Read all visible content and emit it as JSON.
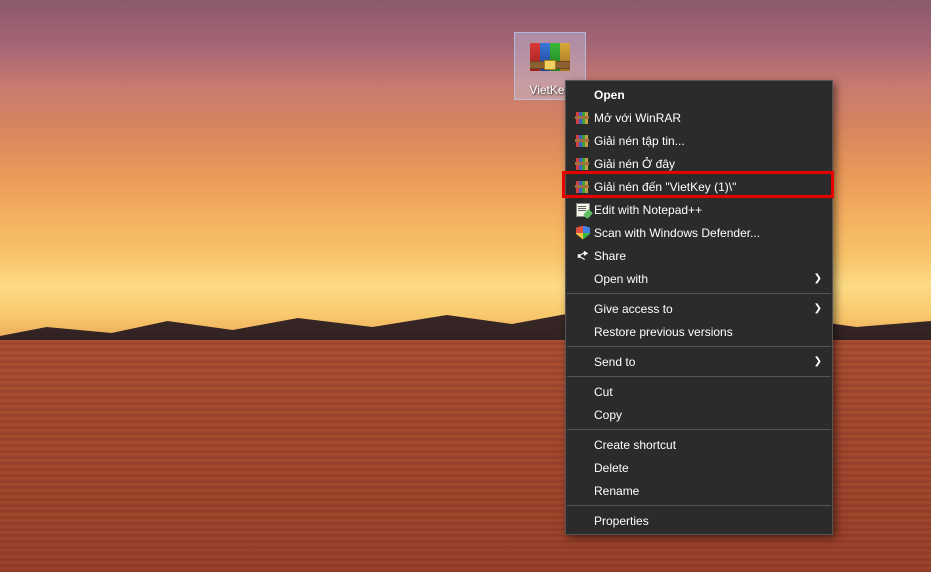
{
  "desktop": {
    "icon_label": "VietKey"
  },
  "context_menu": {
    "items": [
      {
        "label": "Open",
        "icon": null,
        "default": true,
        "submenu": false
      },
      {
        "label": "Mở với WinRAR",
        "icon": "winrar",
        "submenu": false
      },
      {
        "label": "Giải nén tập tin...",
        "icon": "winrar",
        "submenu": false
      },
      {
        "label": "Giải nén Ở đây",
        "icon": "winrar",
        "submenu": false
      },
      {
        "label": "Giải nén đến \"VietKey (1)\\\"",
        "icon": "winrar",
        "submenu": false,
        "highlighted": true
      },
      {
        "label": "Edit with Notepad++",
        "icon": "notepad",
        "submenu": false
      },
      {
        "label": "Scan with Windows Defender...",
        "icon": "shield",
        "submenu": false
      },
      {
        "label": "Share",
        "icon": "share",
        "submenu": false
      },
      {
        "label": "Open with",
        "icon": null,
        "submenu": true
      },
      {
        "sep": true
      },
      {
        "label": "Give access to",
        "icon": null,
        "submenu": true
      },
      {
        "label": "Restore previous versions",
        "icon": null,
        "submenu": false
      },
      {
        "sep": true
      },
      {
        "label": "Send to",
        "icon": null,
        "submenu": true
      },
      {
        "sep": true
      },
      {
        "label": "Cut",
        "icon": null,
        "submenu": false
      },
      {
        "label": "Copy",
        "icon": null,
        "submenu": false
      },
      {
        "sep": true
      },
      {
        "label": "Create shortcut",
        "icon": null,
        "submenu": false
      },
      {
        "label": "Delete",
        "icon": null,
        "submenu": false
      },
      {
        "label": "Rename",
        "icon": null,
        "submenu": false
      },
      {
        "sep": true
      },
      {
        "label": "Properties",
        "icon": null,
        "submenu": false
      }
    ]
  }
}
